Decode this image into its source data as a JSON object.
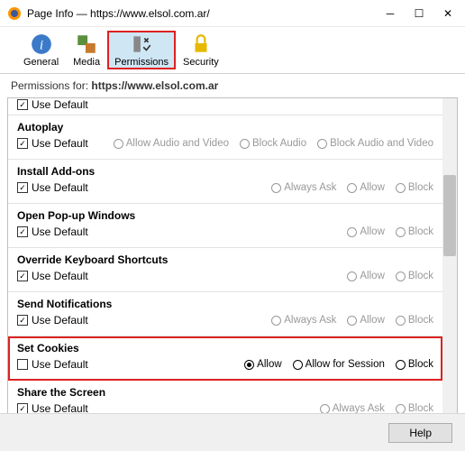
{
  "window": {
    "title": "Page Info — https://www.elsol.com.ar/"
  },
  "tabs": {
    "general": "General",
    "media": "Media",
    "permissions": "Permissions",
    "security": "Security"
  },
  "perm_header": {
    "label": "Permissions for:",
    "url": "https://www.elsol.com.ar"
  },
  "labels": {
    "use_default": "Use Default",
    "allow": "Allow",
    "block": "Block",
    "always_ask": "Always Ask",
    "allow_audio_video": "Allow Audio and Video",
    "block_audio": "Block Audio",
    "block_audio_video": "Block Audio and Video",
    "allow_for_session": "Allow for Session"
  },
  "sections": {
    "autoplay": {
      "title": "Autoplay",
      "use_default": true
    },
    "install_addons": {
      "title": "Install Add-ons",
      "use_default": true
    },
    "popups": {
      "title": "Open Pop-up Windows",
      "use_default": true
    },
    "override_shortcuts": {
      "title": "Override Keyboard Shortcuts",
      "use_default": true
    },
    "send_notifications": {
      "title": "Send Notifications",
      "use_default": true
    },
    "set_cookies": {
      "title": "Set Cookies",
      "use_default": false,
      "selected": "allow"
    },
    "share_screen": {
      "title": "Share the Screen",
      "use_default": true
    }
  },
  "footer": {
    "help": "Help"
  }
}
